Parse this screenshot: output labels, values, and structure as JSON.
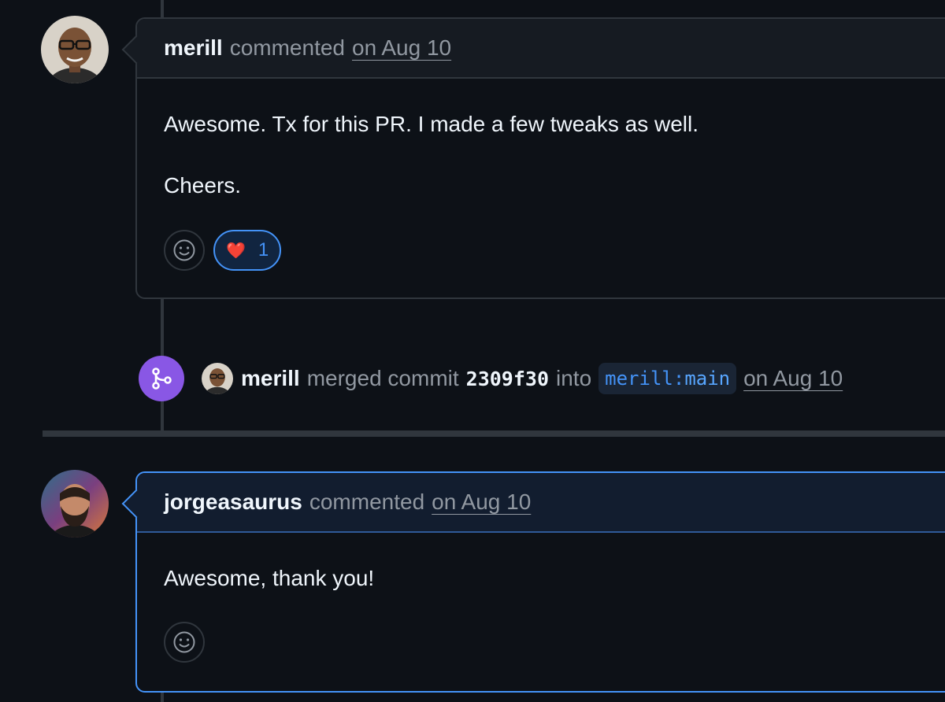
{
  "comment1": {
    "author": "merill",
    "action": "commented",
    "date": "on Aug 10",
    "paragraphs": [
      "Awesome. Tx for this PR. I made a few tweaks as well.",
      "Cheers."
    ],
    "reactions": [
      {
        "emoji": "❤️",
        "count": "1"
      }
    ]
  },
  "merge_event": {
    "author": "merill",
    "action": "merged commit",
    "commit": "2309f30",
    "into": "into",
    "branch_repo": "merill",
    "branch_name": "main",
    "date": "on Aug 10"
  },
  "comment2": {
    "author": "jorgeasaurus",
    "action": "commented",
    "date": "on Aug 10",
    "paragraphs": [
      "Awesome, thank you!"
    ],
    "reactions": []
  },
  "colors": {
    "accent": "#4493f8",
    "merge": "#8957e5",
    "background": "#0d1117"
  },
  "icons": {
    "add_reaction": "smiley-icon",
    "merge": "git-merge-icon"
  }
}
